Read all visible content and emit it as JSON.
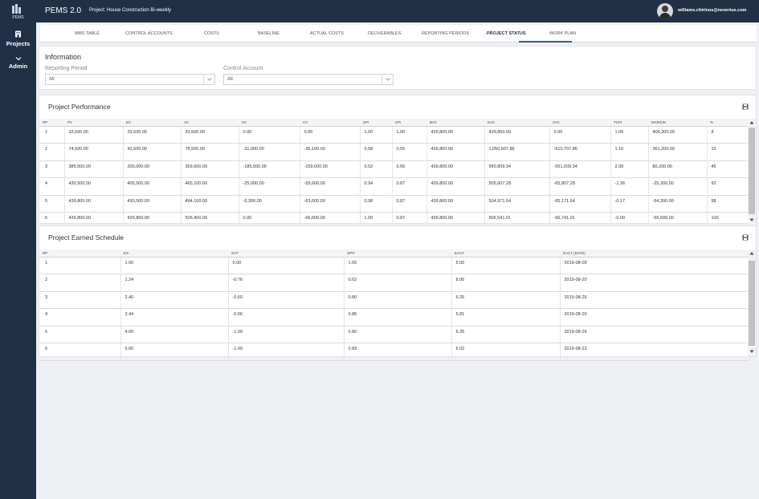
{
  "app": {
    "logo_text": "PEMS",
    "title": "PEMS 2.0",
    "project": "Project: House Construction Bi-weekly",
    "user_email": "williams.chirinos@nexertus.com"
  },
  "sidebar": {
    "items": [
      {
        "label": "Projects",
        "icon": "building-icon"
      },
      {
        "label": "Admin",
        "icon": "chevron-down-icon"
      }
    ]
  },
  "tabs": [
    {
      "label": "WBS TABLE"
    },
    {
      "label": "CONTROL ACCOUNTS"
    },
    {
      "label": "COSTS"
    },
    {
      "label": "BASELINE"
    },
    {
      "label": "ACTUAL COSTS"
    },
    {
      "label": "DELIVERABLES"
    },
    {
      "label": "REPORTING PERIODS"
    },
    {
      "label": "PROJECT STATUS",
      "active": true
    },
    {
      "label": "WORK PLAN"
    }
  ],
  "information": {
    "title": "Information",
    "reporting_period": {
      "label": "Reporting Period",
      "value": "All"
    },
    "control_account": {
      "label": "Control Account",
      "value": "All"
    }
  },
  "performance": {
    "title": "Project Performance",
    "columns": [
      "RP",
      "PV",
      "EV",
      "AC",
      "SV",
      "CV",
      "SPI",
      "CPI",
      "BAC",
      "EAC",
      "VAC",
      "TCPI",
      "MARGIN",
      "%"
    ],
    "rows": [
      [
        "1",
        "33,500.00",
        "33,500.00",
        "33,500.00",
        "0.00",
        "0.00",
        "1.00",
        "1.00",
        "439,800.00",
        "439,800.00",
        "0.00",
        "1.00",
        "406,300.00",
        "8"
      ],
      [
        "2",
        "74,500.00",
        "43,500.00",
        "78,600.00",
        "-31,000.00",
        "-35,100.00",
        "0.58",
        "0.55",
        "439,800.00",
        "1,050,507.86",
        "-610,707.86",
        "1.10",
        "361,200.00",
        "10"
      ],
      [
        "3",
        "385,500.00",
        "200,000.00",
        "359,600.00",
        "-185,500.00",
        "-159,600.00",
        "0.52",
        "0.56",
        "439,800.00",
        "990,809.34",
        "-551,009.34",
        "2.99",
        "80,200.00",
        "45"
      ],
      [
        "4",
        "430,500.00",
        "405,500.00",
        "465,100.00",
        "-25,000.00",
        "-59,600.00",
        "0.94",
        "0.87",
        "439,800.00",
        "505,607.28",
        "-65,807.28",
        "-1.36",
        "-25,300.00",
        "92"
      ],
      [
        "5",
        "439,800.00",
        "430,500.00",
        "494,100.00",
        "-9,300.00",
        "-63,600.00",
        "0.98",
        "0.87",
        "439,800.00",
        "504,971.64",
        "-65,171.64",
        "-0.17",
        "-54,300.00",
        "98"
      ],
      [
        "6",
        "439,800.00",
        "439,800.00",
        "506,400.00",
        "0.00",
        "-66,600.00",
        "1.00",
        "0.87",
        "439,800.00",
        "506,541.01",
        "-66,741.01",
        "-0.00",
        "-66,600.00",
        "100"
      ]
    ]
  },
  "earned_schedule": {
    "title": "Project Earned Schedule",
    "columns": [
      "RP",
      "ES",
      "SVT",
      "SPIT",
      "EACT",
      "EACT (DATE)"
    ],
    "rows": [
      [
        "1",
        "1.00",
        "0.00",
        "1.00",
        "5.00",
        "2019-08-09"
      ],
      [
        "2",
        "1.24",
        "-0.76",
        "0.62",
        "8.06",
        "2019-09-20"
      ],
      [
        "3",
        "2.40",
        "-0.60",
        "0.80",
        "6.25",
        "2019-08-26"
      ],
      [
        "4",
        "3.44",
        "-0.56",
        "0.86",
        "5.81",
        "2019-08-20"
      ],
      [
        "5",
        "4.00",
        "-1.00",
        "0.80",
        "6.25",
        "2019-08-26"
      ],
      [
        "6",
        "5.00",
        "-1.00",
        "0.83",
        "6.02",
        "2019-08-23"
      ]
    ]
  }
}
